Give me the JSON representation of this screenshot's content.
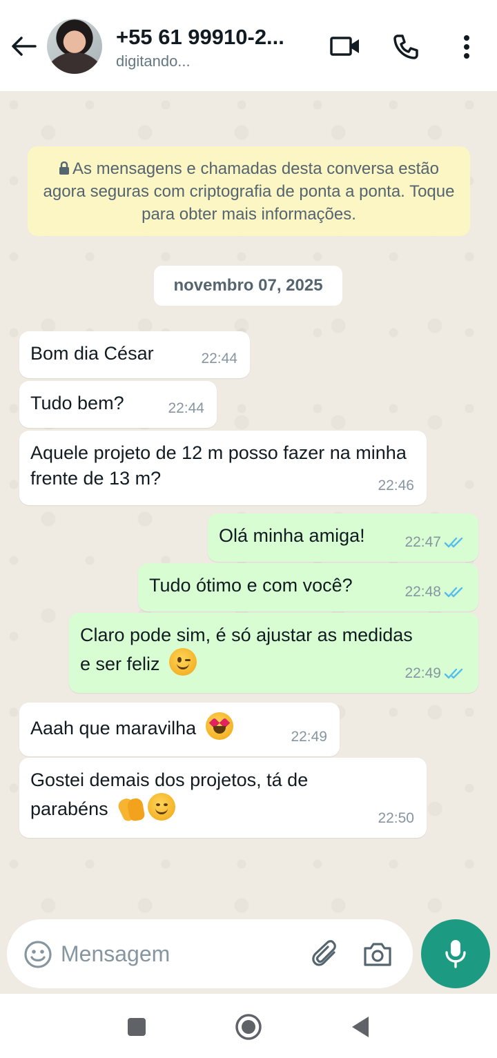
{
  "header": {
    "contact_name": "+55 61 99910-2...",
    "status": "digitando..."
  },
  "encryption_notice": "As mensagens e chamadas desta conversa estão agora seguras com criptografia de ponta a ponta. Toque para obter mais informações.",
  "date_chip": "novembro 07, 2025",
  "messages": [
    {
      "direction": "in",
      "text": "Bom dia César",
      "time": "22:44"
    },
    {
      "direction": "in",
      "text": "Tudo bem?",
      "time": "22:44"
    },
    {
      "direction": "in",
      "text": "Aquele projeto de 12 m posso fazer na minha frente de 13 m?",
      "time": "22:46"
    },
    {
      "direction": "out",
      "text": "Olá minha amiga!",
      "time": "22:47",
      "status": "read"
    },
    {
      "direction": "out",
      "text": "Tudo ótimo e com você?",
      "time": "22:48",
      "status": "read"
    },
    {
      "direction": "out",
      "text": "Claro pode sim, é só ajustar as medidas e ser feliz",
      "emoji": "winking-face",
      "time": "22:49",
      "status": "read"
    },
    {
      "direction": "in",
      "text": "Aaah que maravilha",
      "emoji": "heart-eyes-face",
      "time": "22:49"
    },
    {
      "direction": "in",
      "text": "Gostei demais dos projetos, tá de parabéns",
      "emoji": "clapping-hands, smiling-face",
      "time": "22:50"
    }
  ],
  "input": {
    "placeholder": "Mensagem"
  },
  "colors": {
    "chat_background": "#efeae2",
    "outgoing_bubble": "#d9fdd3",
    "incoming_bubble": "#ffffff",
    "accent": "#1c9b82",
    "read_tick": "#53bdeb",
    "encryption_bg": "#fcf5c4"
  },
  "icons": [
    "back-arrow-icon",
    "video-call-icon",
    "phone-icon",
    "more-vert-icon",
    "lock-icon",
    "double-check-icon",
    "emoji-icon",
    "paperclip-icon",
    "camera-icon",
    "mic-icon",
    "recents-icon",
    "home-icon",
    "back-icon"
  ]
}
